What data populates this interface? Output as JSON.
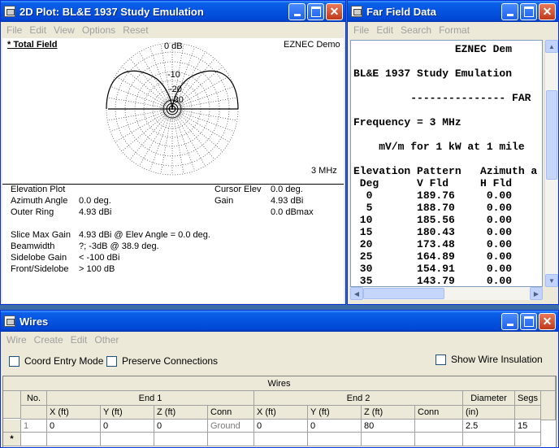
{
  "plot_window": {
    "title": "2D Plot: BL&E 1937 Study Emulation",
    "menu": [
      "File",
      "Edit",
      "View",
      "Options",
      "Reset"
    ],
    "plot_label": "* Total Field",
    "brand": "EZNEC Demo",
    "freq_label": "3 MHz",
    "ring_labels": [
      "0 dB",
      "-10",
      "-20",
      "-30"
    ],
    "info": {
      "plot_type": "Elevation Plot",
      "azimuth_label": "Azimuth Angle",
      "azimuth_value": "0.0 deg.",
      "outer_ring_label": "Outer Ring",
      "outer_ring_value": "4.93 dBi",
      "cursor_elev_label": "Cursor Elev",
      "cursor_elev_value": "0.0 deg.",
      "gain_label": "Gain",
      "gain_value": "4.93 dBi",
      "gain_max": "0.0 dBmax",
      "slice_max_label": "Slice Max Gain",
      "slice_max_value": "4.93 dBi @ Elev Angle = 0.0 deg.",
      "beamwidth_label": "Beamwidth",
      "beamwidth_value": "?; -3dB @ 38.9 deg.",
      "sidelobe_label": "Sidelobe Gain",
      "sidelobe_value": "< -100 dBi",
      "front_label": "Front/Sidelobe",
      "front_value": "> 100 dB"
    }
  },
  "ff_window": {
    "title": "Far Field Data",
    "menu": [
      "File",
      "Edit",
      "Search",
      "Format"
    ],
    "lines": [
      "                EZNEC Dem",
      "BL&E 1937 Study Emulation",
      "         --------------- FAR",
      "Frequency = 3 MHz",
      "    mV/m for 1 kW at 1 mile",
      "Elevation Pattern   Azimuth a",
      " Deg      V Fld     H Fld",
      "  0       189.76     0.00",
      "  5       188.70     0.00",
      " 10       185.56     0.00",
      " 15       180.43     0.00",
      " 20       173.48     0.00",
      " 25       164.89     0.00",
      " 30       154.91     0.00",
      " 35       143.79     0.00"
    ]
  },
  "wires_window": {
    "title": "Wires",
    "menu": [
      "Wire",
      "Create",
      "Edit",
      "Other"
    ],
    "coord_entry": "Coord Entry Mode",
    "preserve": "Preserve Connections",
    "show_insulation": "Show Wire Insulation",
    "grid_title": "Wires",
    "headers": {
      "no": "No.",
      "end1": "End 1",
      "end2": "End 2",
      "diameter": "Diameter",
      "segs": "Segs",
      "x": "X  (ft)",
      "y": "Y  (ft)",
      "z": "Z  (ft)",
      "conn": "Conn",
      "in": "(in)"
    },
    "rows": [
      {
        "no": "1",
        "x1": "0",
        "y1": "0",
        "z1": "0",
        "conn1": "Ground",
        "x2": "0",
        "y2": "0",
        "z2": "80",
        "conn2": "",
        "dia": "2.5",
        "segs": "15"
      }
    ],
    "new_row_marker": "*"
  }
}
